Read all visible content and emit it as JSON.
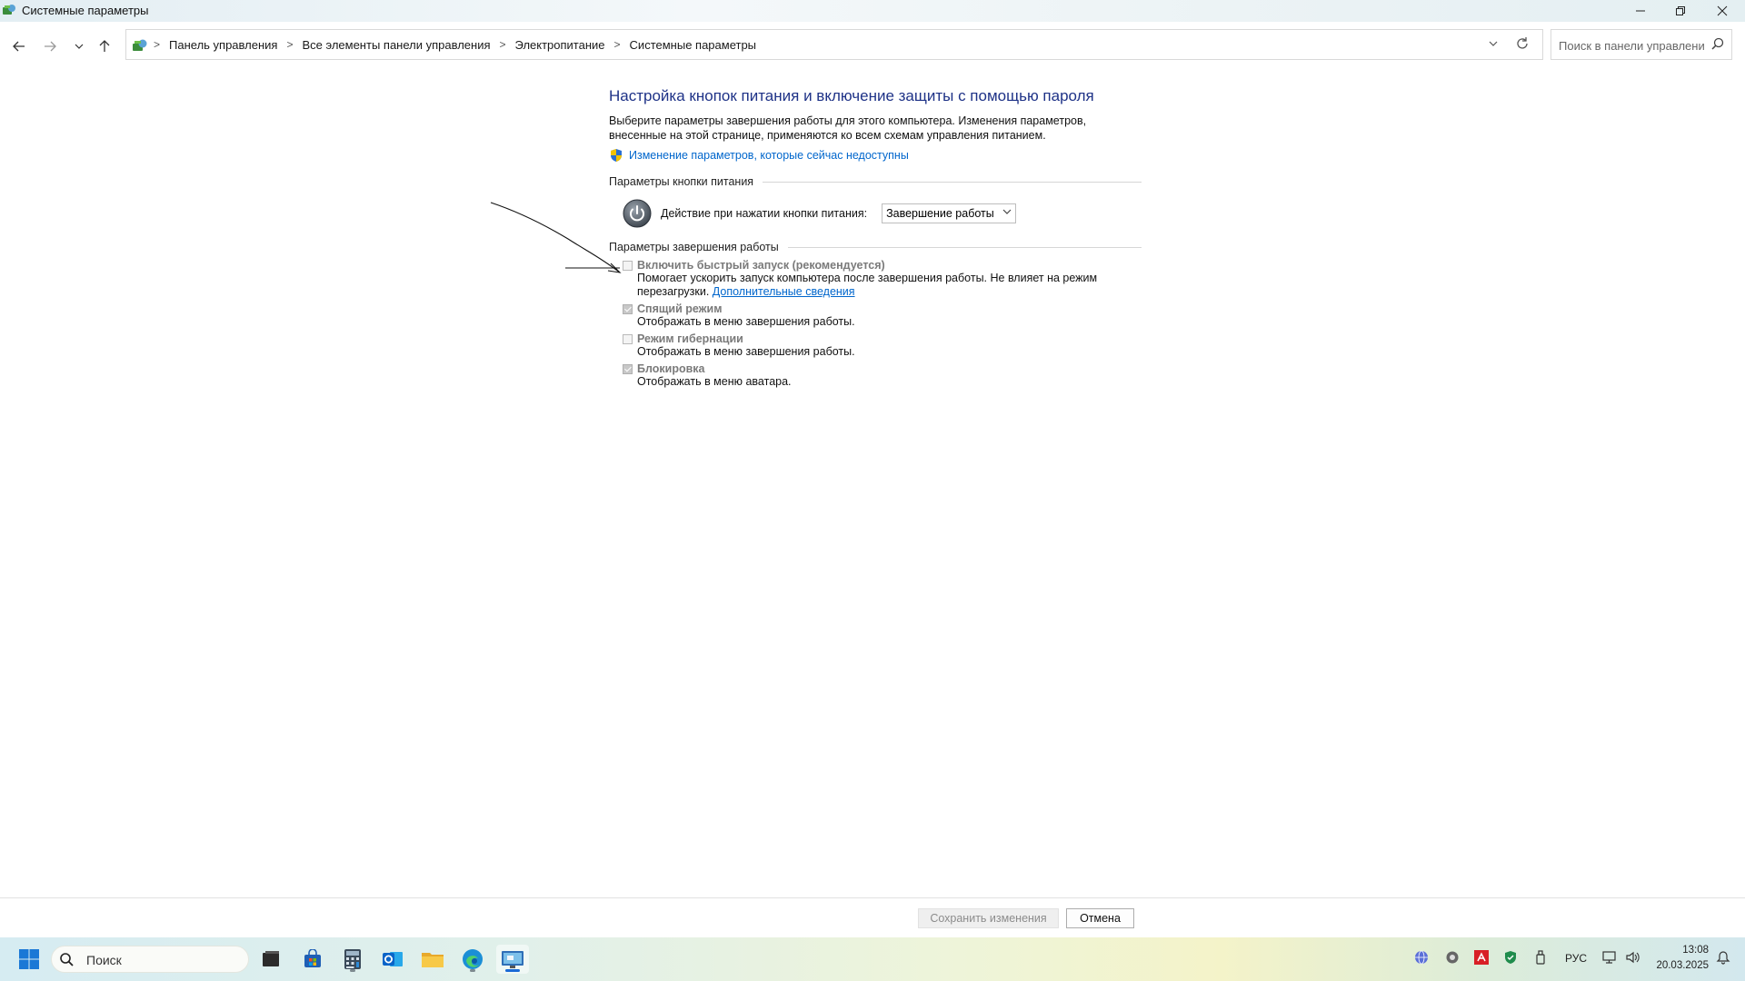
{
  "window": {
    "title": "Системные параметры"
  },
  "nav": {
    "breadcrumbs": [
      "Панель управления",
      "Все элементы панели управления",
      "Электропитание",
      "Системные параметры"
    ],
    "search_placeholder": "Поиск в панели управления"
  },
  "main": {
    "title": "Настройка кнопок питания и включение защиты с помощью пароля",
    "description": "Выберите параметры завершения работы для этого компьютера. Изменения параметров, внесенные на этой странице, применяются ко всем схемам управления питанием.",
    "admin_link": "Изменение параметров, которые сейчас недоступны",
    "power_group": {
      "header": "Параметры кнопки питания",
      "action_label": "Действие при нажатии кнопки питания:",
      "action_value": "Завершение работы"
    },
    "shutdown_group": {
      "header": "Параметры завершения работы",
      "fast_startup": {
        "title": "Включить быстрый запуск (рекомендуется)",
        "desc_part1": "Помогает ускорить запуск компьютера после завершения работы. Не влияет на режим",
        "desc_part2": "перезагрузки.",
        "more_link": "Дополнительные сведения",
        "checked": false
      },
      "sleep": {
        "title": "Спящий режим",
        "desc": "Отображать в меню завершения работы.",
        "checked": true
      },
      "hibernate": {
        "title": "Режим гибернации",
        "desc": "Отображать в меню завершения работы.",
        "checked": false
      },
      "lock": {
        "title": "Блокировка",
        "desc": "Отображать в меню аватара.",
        "checked": true
      }
    }
  },
  "footer": {
    "save_label": "Сохранить изменения",
    "cancel_label": "Отмена"
  },
  "taskbar": {
    "search_label": "Поиск",
    "language": "РУС",
    "time": "13:08",
    "date": "20.03.2025"
  },
  "colors": {
    "title_blue": "#1e3287",
    "link_blue": "#0066cc",
    "accent": "#1a6ad6"
  }
}
